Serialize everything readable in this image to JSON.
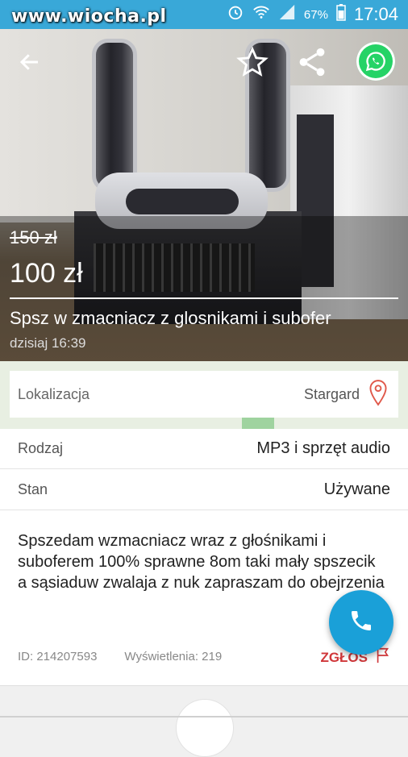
{
  "watermark": "www.wiocha.pl",
  "status_bar": {
    "battery": "67%",
    "time": "17:04"
  },
  "toolbar": {
    "back_icon": "arrow-left-icon",
    "favorite_icon": "star-outline-icon",
    "share_icon": "share-icon",
    "whatsapp_icon": "whatsapp-icon"
  },
  "listing": {
    "old_price": "150 zł",
    "price": "100 zł",
    "title": "Spsz w zmacniacz z glosnikami i subofer",
    "date": "dzisiaj 16:39"
  },
  "location": {
    "label": "Lokalizacja",
    "value": "Stargard"
  },
  "attributes": [
    {
      "key": "Rodzaj",
      "value": "MP3 i sprzęt audio"
    },
    {
      "key": "Stan",
      "value": "Używane"
    }
  ],
  "description": "Spszedam wzmacniacz wraz z głośnikami i suboferem 100% sprawne  8om taki mały spszecik a sąsiaduw zwalaja z nuk zapraszam do obejrzenia",
  "meta": {
    "id": "ID: 214207593",
    "views": "Wyświetlenia: 219"
  },
  "report_label": "ZGŁOŚ",
  "colors": {
    "statusbar": "#39a8d8",
    "accent": "#1aa0d8",
    "report": "#d0373a",
    "whatsapp": "#25d366"
  }
}
